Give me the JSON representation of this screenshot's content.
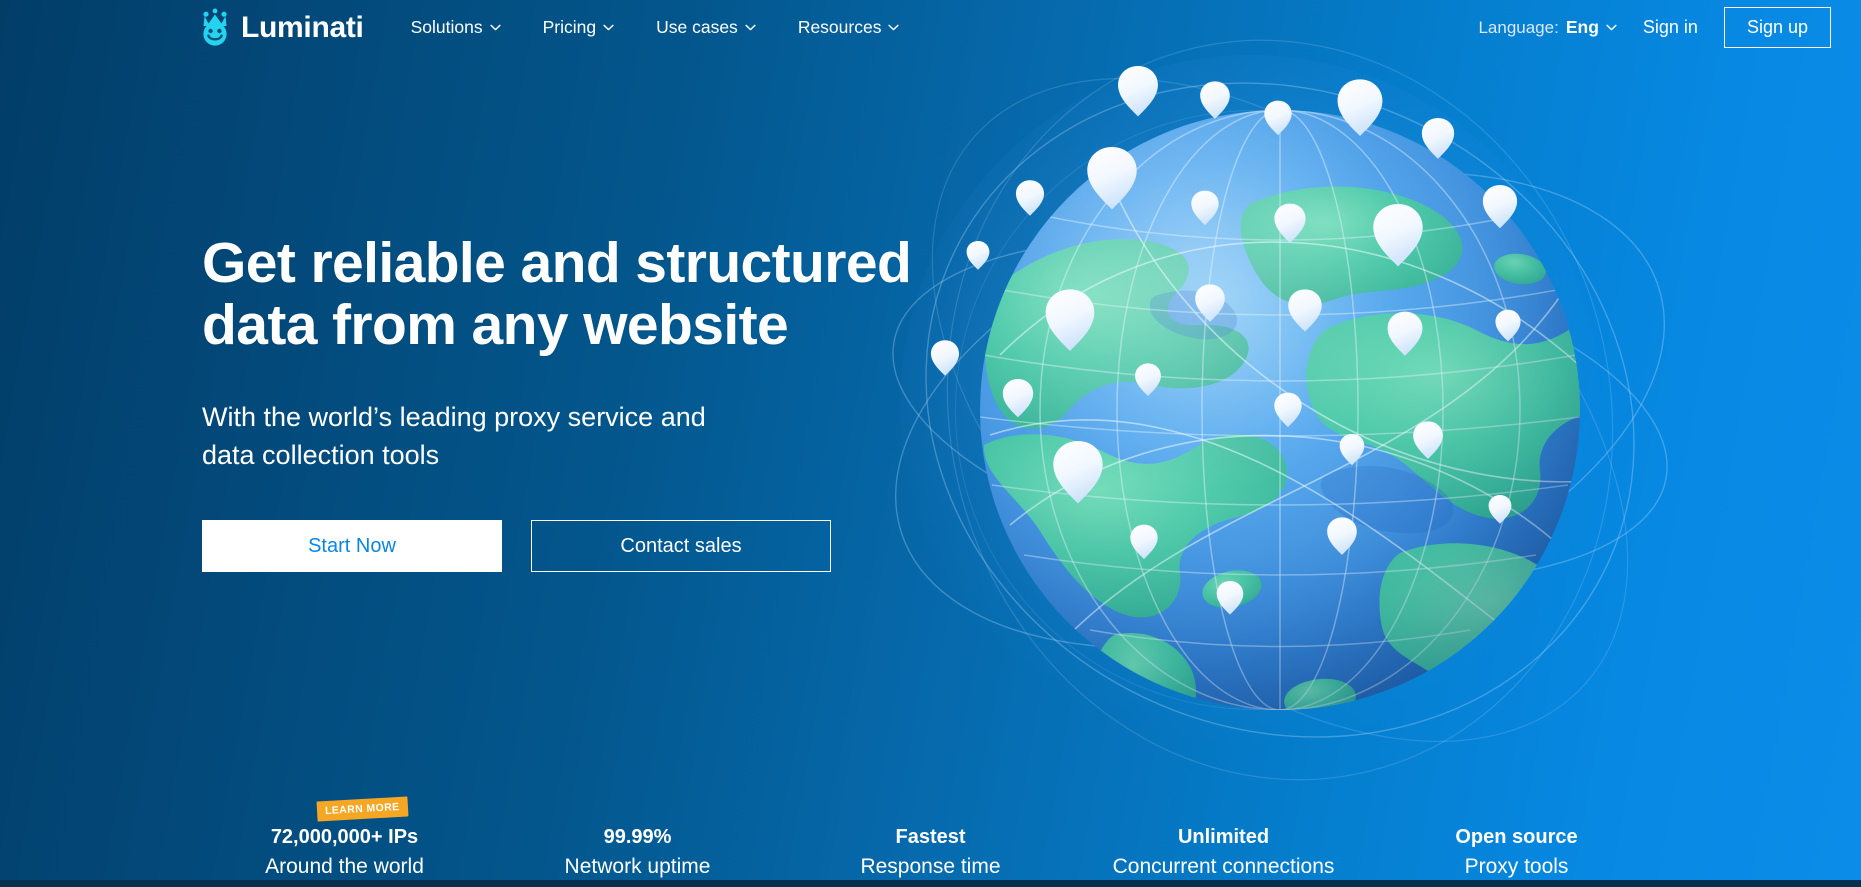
{
  "brand": {
    "name": "Luminati",
    "logo_icon": "crowned-smiley-logo-icon"
  },
  "header": {
    "nav": [
      {
        "label": "Solutions",
        "icon": "chevron-down-icon"
      },
      {
        "label": "Pricing",
        "icon": "chevron-down-icon"
      },
      {
        "label": "Use cases",
        "icon": "chevron-down-icon"
      },
      {
        "label": "Resources",
        "icon": "chevron-down-icon"
      }
    ],
    "language_label": "Language:",
    "language_value": "Eng",
    "language_icon": "chevron-down-icon",
    "sign_in": "Sign in",
    "sign_up": "Sign up"
  },
  "hero": {
    "headline_line1": "Get reliable and structured",
    "headline_line2": "data from any website",
    "subheadline_line1": "With the world’s leading proxy service and",
    "subheadline_line2": "data collection tools",
    "primary_cta": "Start Now",
    "secondary_cta": "Contact sales"
  },
  "stats": [
    {
      "value": "72,000,000+ IPs",
      "label": "Around the world",
      "badge": "LEARN MORE"
    },
    {
      "value": "99.99%",
      "label": "Network uptime",
      "badge": null
    },
    {
      "value": "Fastest",
      "label": "Response time",
      "badge": null
    },
    {
      "value": "Unlimited",
      "label": "Concurrent connections",
      "badge": null
    },
    {
      "value": "Open source",
      "label": "Proxy tools",
      "badge": null
    }
  ],
  "illustration": {
    "name": "world-globe-with-location-pins",
    "description": "Blue globe with teal continents, orbital arc lines and white map pins"
  },
  "colors": {
    "background_left": "#023d68",
    "background_right": "#0a8ce8",
    "accent_cyan": "#27d3ef",
    "badge_amber": "#f5a623",
    "primary_button_text": "#0b85e5",
    "land_teal": "#3fc3a4",
    "ocean_blue": "#3f9fe8",
    "bottom_bar": "#06304f"
  }
}
